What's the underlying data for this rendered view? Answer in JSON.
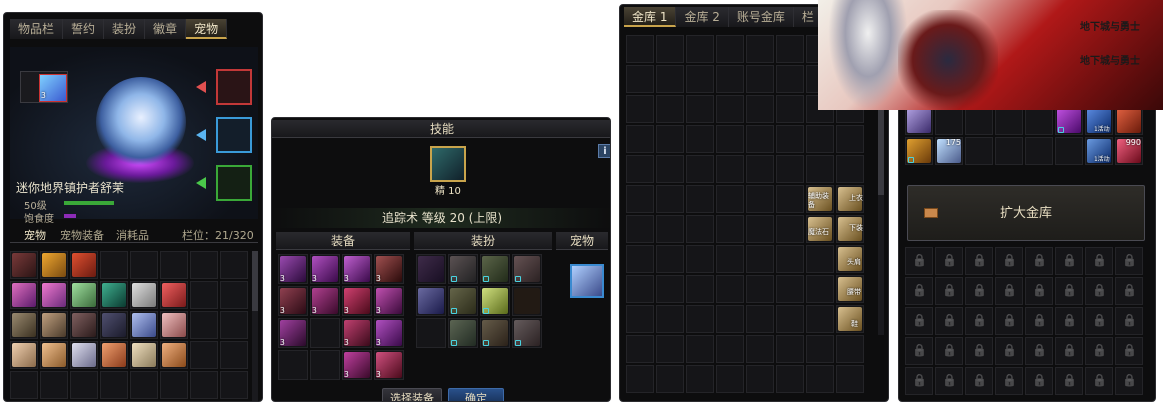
{
  "colors": {
    "gold": "#c9a44c",
    "cyan": "#4ad2e0",
    "green": "#3aa838",
    "purple": "#8c2bb8"
  },
  "inventory": {
    "tabs": [
      "物品栏",
      "誓约",
      "装扮",
      "徽章",
      "宠物"
    ],
    "active_tab": "宠物",
    "info_icon": "i",
    "pet_name": "迷你地界镇护者舒茉",
    "level_label": "50级",
    "satiety_label": "饱食度",
    "subtabs": [
      "宠物",
      "宠物装备",
      "消耗品"
    ],
    "slots_label": "栏位：21/320",
    "small_badge": "3"
  },
  "skill": {
    "header": "技能",
    "info_icon": "i",
    "skill_badge": "精 10",
    "skill_desc": "追踪术 等级 20 (上限)",
    "sections": [
      "装备",
      "装扮",
      "宠物"
    ],
    "select_button": "选择装备",
    "confirm_button": "确定"
  },
  "storage": {
    "tabs": [
      "金库 1",
      "金库 2",
      "账号金库",
      "栏"
    ],
    "labels": [
      "辅助装备",
      "上衣",
      "魔法石",
      "下装",
      "头肩",
      "腰带",
      "鞋"
    ]
  },
  "right_storage": {
    "expand_button": "扩大金库",
    "counts": [
      "175",
      "990"
    ],
    "mini_labels": [
      "1活动",
      "1活动"
    ]
  },
  "banner": {
    "logo_lines": [
      "地下城与勇士",
      "地下城与勇士"
    ]
  }
}
